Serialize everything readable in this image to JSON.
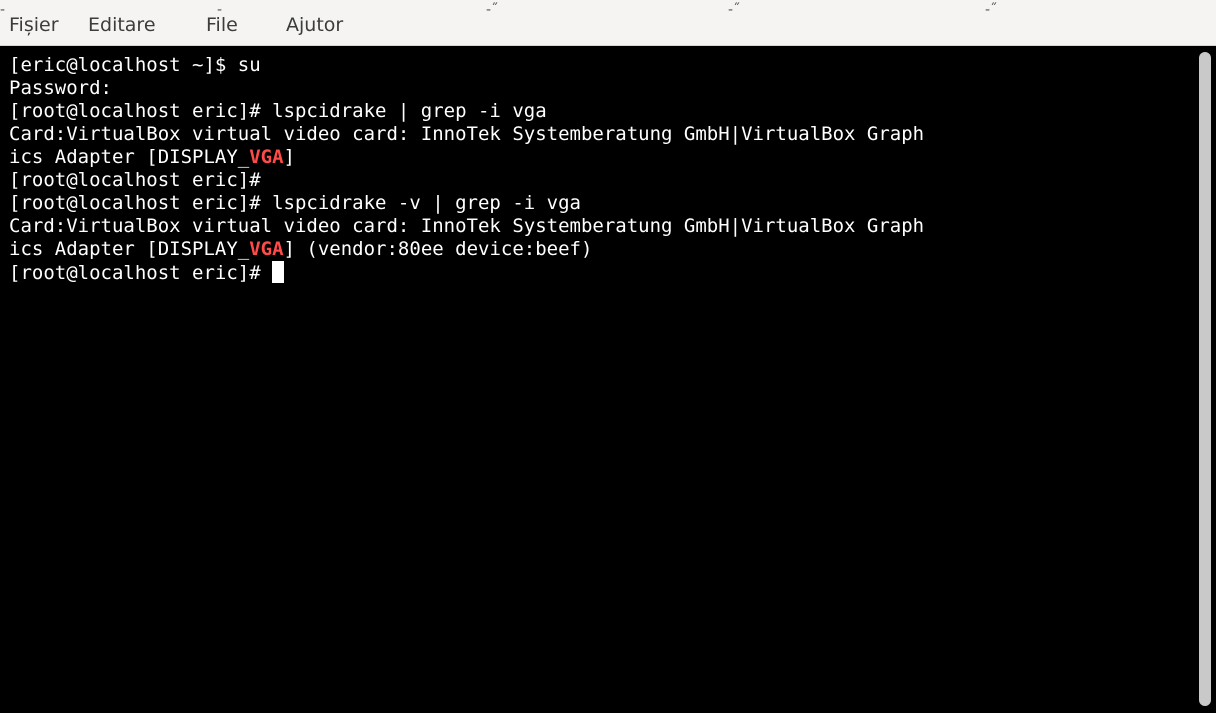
{
  "menubar": {
    "items": [
      {
        "label": "Fișier"
      },
      {
        "label": "Editare"
      },
      {
        "label": "File"
      },
      {
        "label": "Ajutor"
      }
    ]
  },
  "terminal": {
    "highlight_color": "#ff4a4a",
    "lines": [
      {
        "text": "[eric@localhost ~]$ su"
      },
      {
        "text": "Password:"
      },
      {
        "text": "[root@localhost eric]# lspcidrake | grep -i vga"
      },
      {
        "text": "Card:VirtualBox virtual video card: InnoTek Systemberatung GmbH|VirtualBox Graph"
      },
      {
        "pre": "ics Adapter [DISPLAY_",
        "match": "VGA",
        "post": "]"
      },
      {
        "text": "[root@localhost eric]#"
      },
      {
        "text": "[root@localhost eric]# lspcidrake -v | grep -i vga"
      },
      {
        "text": "Card:VirtualBox virtual video card: InnoTek Systemberatung GmbH|VirtualBox Graph"
      },
      {
        "pre": "ics Adapter [DISPLAY_",
        "match": "VGA",
        "post": "] (vendor:80ee device:beef)"
      },
      {
        "prompt": "[root@localhost eric]# "
      }
    ]
  }
}
